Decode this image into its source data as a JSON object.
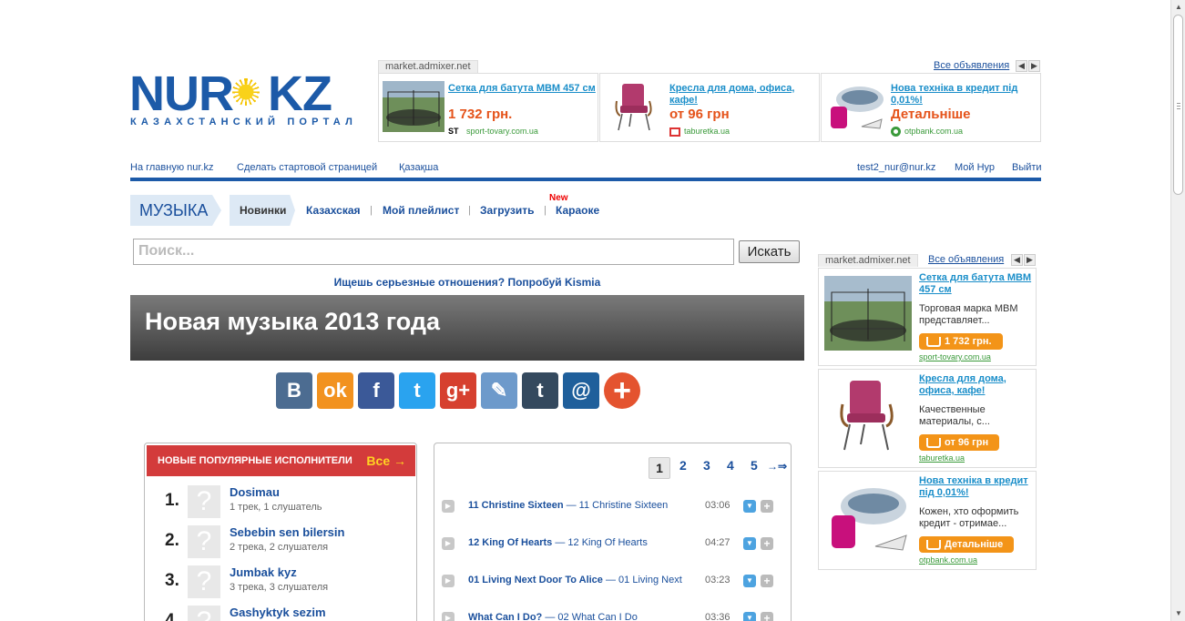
{
  "logo": {
    "left": "NUR",
    "right": "KZ",
    "subtitle": "КАЗАХСТАНСКИЙ ПОРТАЛ"
  },
  "top_ad": {
    "tab": "market.admixer.net",
    "all_link": "Все объявления",
    "items": [
      {
        "title": "Сетка для батута MBM 457 см",
        "price": "1 732 грн.",
        "source": "sport-tovary.com.ua"
      },
      {
        "title": "Кресла для дома, офиса, кафе!",
        "price": "от 96 грн",
        "source": "taburetka.ua"
      },
      {
        "title": "Нова техніка в кредит під 0,01%!",
        "price": "Детальніше",
        "source": "otpbank.com.ua"
      }
    ]
  },
  "nav": {
    "home": "На главную nur.kz",
    "make_start": "Сделать стартовой страницей",
    "kazakh": "Қазақша",
    "user": "test2_nur@nur.kz",
    "my_nur": "Мой Нур",
    "logout": "Выйти"
  },
  "music_tabs": {
    "section": "МУЗЫКА",
    "active": "Новинки",
    "items": [
      "Казахская",
      "Мой плейлист",
      "Загрузить",
      "Караоке"
    ],
    "separator": "|",
    "new_badge": "New"
  },
  "search": {
    "placeholder": "Поиск...",
    "button": "Искать"
  },
  "promo": "Ищешь серьезные отношения? Попробуй Kismia",
  "banner_title": "Новая музыка 2013 года",
  "social": [
    {
      "icon": "vk-icon",
      "glyph": "В",
      "color": "#4c6c91"
    },
    {
      "icon": "odnoklassniki-icon",
      "glyph": "ok",
      "color": "#f2921f"
    },
    {
      "icon": "facebook-icon",
      "glyph": "f",
      "color": "#3b5998"
    },
    {
      "icon": "twitter-icon",
      "glyph": "t",
      "color": "#2aa3ef"
    },
    {
      "icon": "googleplus-icon",
      "glyph": "g+",
      "color": "#d6402f"
    },
    {
      "icon": "livejournal-icon",
      "glyph": "✎",
      "color": "#6d9acb"
    },
    {
      "icon": "tumblr-icon",
      "glyph": "t",
      "color": "#34495e"
    },
    {
      "icon": "mail-icon",
      "glyph": "@",
      "color": "#1f5f9b"
    },
    {
      "icon": "more-icon",
      "glyph": "+",
      "color": "#e4532f"
    }
  ],
  "popular": {
    "header": "НОВЫЕ ПОПУЛЯРНЫЕ ИСПОЛНИТЕЛИ",
    "all": "Все →",
    "artists": [
      {
        "num": "1.",
        "name": "Dosimau",
        "meta": "1 трек, 1 слушатель"
      },
      {
        "num": "2.",
        "name": "Sebebin sen bilersin",
        "meta": "2 трека, 2 слушателя"
      },
      {
        "num": "3.",
        "name": "Jumbak kyz",
        "meta": "3 трека, 3 слушателя"
      },
      {
        "num": "4.",
        "name": "Gashyktyk sezim",
        "meta": ""
      }
    ]
  },
  "pagination": {
    "active": "1",
    "pages": [
      "2",
      "3",
      "4",
      "5"
    ],
    "next": "→⇒"
  },
  "tracks": [
    {
      "artist": "11 Christine Sixteen",
      "title": "— 11 Christine Sixteen",
      "duration": "03:06"
    },
    {
      "artist": "12 King Of Hearts",
      "title": "— 12 King Of Hearts",
      "duration": "04:27"
    },
    {
      "artist": "01 Living Next Door To Alice",
      "title": "— 01 Living Next",
      "duration": "03:23"
    },
    {
      "artist": "What Can I Do?",
      "title": "— 02 What Can I Do",
      "duration": "03:36"
    }
  ],
  "right_ad": {
    "tab": "market.admixer.net",
    "all_link": "Все объявления",
    "items": [
      {
        "title": "Сетка для батута MBM 457 см",
        "desc": "Торговая марка MBM представляет...",
        "price": "1 732 грн.",
        "source": "sport-tovary.com.ua"
      },
      {
        "title": "Кресла для дома, офиса, кафе!",
        "desc": "Качественные материалы, с...",
        "price": "от 96 грн",
        "source": "taburetka.ua"
      },
      {
        "title": "Нова техніка в кредит під 0,01%!",
        "desc": "Кожен, хто оформить кредит - отримае...",
        "price": "Детальніше",
        "source": "otpbank.com.ua"
      }
    ]
  },
  "colors": {
    "brand_blue": "#1c5aa8",
    "link": "#1a4f9c",
    "ad_link": "#1a8ec9",
    "price_orange": "#e5531a",
    "header_red": "#d33b3b"
  }
}
